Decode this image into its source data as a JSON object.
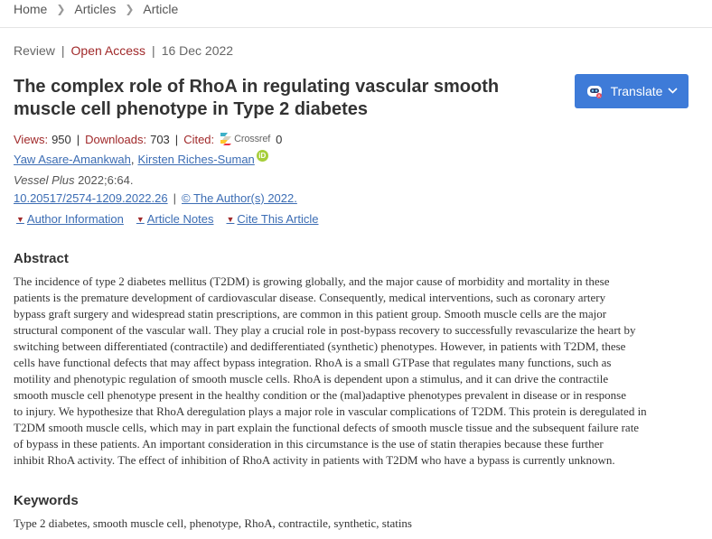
{
  "breadcrumb": {
    "items": [
      "Home",
      "Articles",
      "Article"
    ]
  },
  "meta": {
    "type": "Review",
    "access": "Open Access",
    "date": "16 Dec 2022"
  },
  "title": "The complex role of RhoA in regulating vascular smooth muscle cell phenotype in Type 2 diabetes",
  "translate": {
    "label": "Translate"
  },
  "stats": {
    "views_label": "Views:",
    "views": "950",
    "downloads_label": "Downloads:",
    "downloads": "703",
    "cited_label": "Cited:",
    "crossref_label": "Crossref",
    "cited": "0"
  },
  "authors": [
    "Yaw Asare-Amankwah",
    "Kirsten Riches-Suman"
  ],
  "journal": {
    "name": "Vessel Plus",
    "citation": "2022;6:64."
  },
  "doi": {
    "text": "10.20517/2574-1209.2022.26",
    "copyright": "© The Author(s) 2022."
  },
  "toggles": [
    "Author Information",
    "Article Notes",
    "Cite This Article"
  ],
  "abstract": {
    "heading": "Abstract",
    "lines": [
      "The incidence of type 2 diabetes mellitus (T2DM) is growing globally, and the major cause of morbidity and mortality in these",
      "patients is the premature development of cardiovascular disease. Consequently, medical interventions, such as coronary artery",
      "bypass graft surgery and widespread statin prescriptions, are common in this patient group. Smooth muscle cells are the major",
      "structural component of the vascular wall. They play a crucial role in post-bypass recovery to successfully revascularize the heart by",
      "switching between differentiated (contractile) and dedifferentiated (synthetic) phenotypes. However, in patients with T2DM, these",
      "cells have functional defects that may affect bypass integration. RhoA is a small GTPase that regulates many functions, such as",
      "motility and phenotypic regulation of smooth muscle cells. RhoA is dependent upon a stimulus, and it can drive the contractile",
      "smooth muscle cell phenotype present in the healthy condition or the (mal)adaptive phenotypes prevalent in disease or in response",
      "to injury. We hypothesize that RhoA deregulation plays a major role in vascular complications of T2DM. This protein is deregulated in",
      "T2DM smooth muscle cells, which may in part explain the functional defects of smooth muscle tissue and the subsequent failure rate",
      "of bypass in these patients. An important consideration in this circumstance is the use of statin therapies because these further",
      "inhibit RhoA activity. The effect of inhibition of RhoA activity in patients with T2DM who have a bypass is currently unknown."
    ]
  },
  "keywords": {
    "heading": "Keywords",
    "text": "Type 2 diabetes, smooth muscle cell, phenotype, RhoA, contractile, synthetic, statins"
  },
  "colors": {
    "accent_red": "#a0292a",
    "link_blue": "#3c6db4",
    "button_blue": "#3e7bd8"
  },
  "icons": [
    "chevron-right-icon",
    "robot-translate-icon",
    "chevron-down-icon",
    "crossref-logo",
    "orcid-icon",
    "caret-down-icon"
  ]
}
